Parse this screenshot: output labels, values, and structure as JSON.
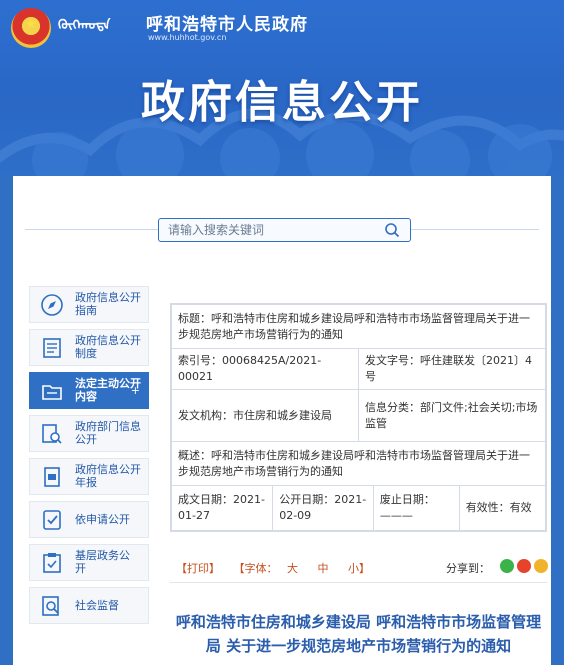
{
  "header": {
    "mongol_text": "ᠬᠥᠬᠡᠬᠣᠲᠠ",
    "site_title": "呼和浩特市人民政府",
    "site_url": "www.huhhot.gov.cn",
    "hero_title": "政府信息公开"
  },
  "search": {
    "placeholder": "请输入搜索关键词"
  },
  "sidebar": {
    "items": [
      {
        "label": "政府信息公开指南",
        "icon": "compass-icon",
        "active": false
      },
      {
        "label": "政府信息公开制度",
        "icon": "document-list-icon",
        "active": false
      },
      {
        "label": "法定主动公开内容",
        "icon": "folder-icon",
        "active": true,
        "badge": "+"
      },
      {
        "label": "政府部门信息公开",
        "icon": "department-search-icon",
        "active": false
      },
      {
        "label": "政府信息公开年报",
        "icon": "report-folder-icon",
        "active": false
      },
      {
        "label": "依申请公开",
        "icon": "checklist-icon",
        "active": false
      },
      {
        "label": "基层政务公　开",
        "icon": "clipboard-check-icon",
        "active": false
      },
      {
        "label": "社会监督",
        "icon": "magnifier-doc-icon",
        "active": false
      }
    ]
  },
  "info": {
    "title": "标题：呼和浩特市住房和城乡建设局呼和浩特市市场监督管理局关于进一步规范房地产市场营销行为的通知",
    "index_no": "索引号：00068425A/2021-00021",
    "doc_no": "发文字号：呼住建联发〔2021〕4号",
    "issuer": "发文机构：市住房和城乡建设局",
    "category": "信息分类：部门文件;社会关切;市场监管",
    "summary": "概述：呼和浩特市住房和城乡建设局呼和浩特市市场监督管理局关于进一步规范房地产市场营销行为的通知",
    "created": "成文日期：2021-01-27",
    "published": "公开日期：2021-02-09",
    "abolished": "废止日期：———",
    "validity": "有效性：有效"
  },
  "toolbar": {
    "print": "【打印】",
    "font": "【字体：",
    "font_large": "大",
    "font_medium": "中",
    "font_small": "小】",
    "share_label": "分享到："
  },
  "article": {
    "title": "呼和浩特市住房和城乡建设局 呼和浩特市市场监督管理局 关于进一步规范房地产市场营销行为的通知"
  },
  "colors": {
    "brand_blue": "#2f6fc4",
    "title_blue": "#2a5dab",
    "accent_orange": "#c6501f"
  }
}
